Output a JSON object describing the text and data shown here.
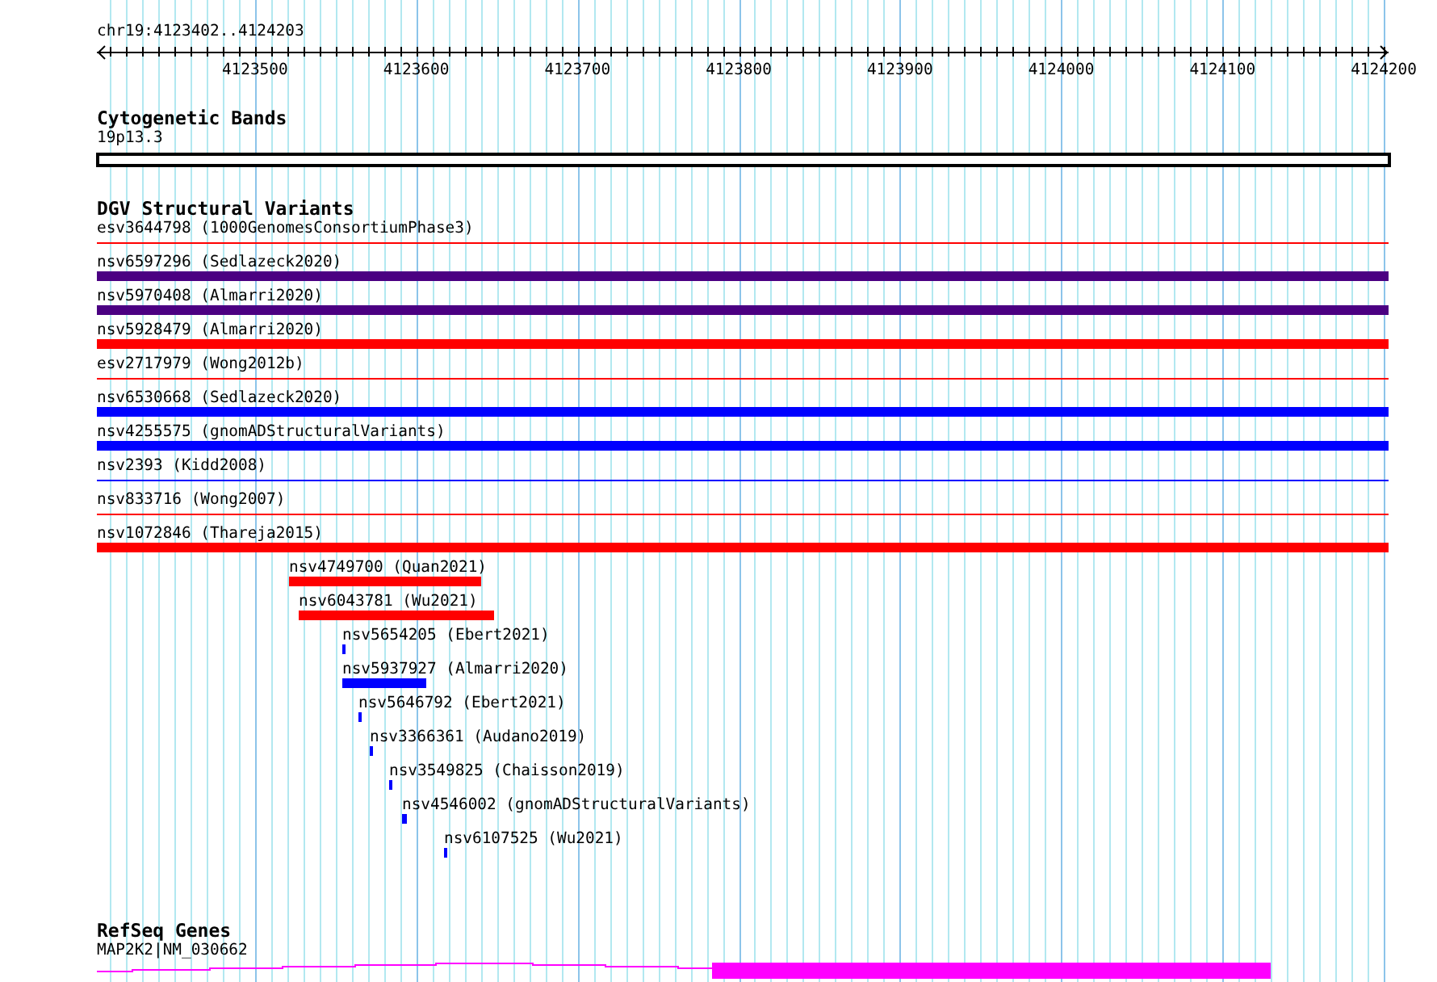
{
  "ruler": {
    "position": "chr19:4123402..4124203",
    "ticks": [
      "4123500",
      "4123600",
      "4123700",
      "4123800",
      "4123900",
      "4124000",
      "4124100",
      "4124200"
    ]
  },
  "tracks": [
    {
      "kind": "bands",
      "title": "Cytogenetic Bands",
      "label": "19p13.3"
    },
    {
      "kind": "variants",
      "title": "DGV Structural Variants",
      "rows": [
        {
          "label": "esv3644798 (1000GenomesConsortiumPhase3)",
          "kind": "line",
          "color": "#ff0000"
        },
        {
          "label": "nsv6597296 (Sedlazeck2020)",
          "kind": "bar",
          "color": "#4b0082"
        },
        {
          "label": "nsv5970408 (Almarri2020)",
          "kind": "bar",
          "color": "#4b0082"
        },
        {
          "label": "nsv5928479 (Almarri2020)",
          "kind": "bar",
          "color": "#ff0000"
        },
        {
          "label": "esv2717979 (Wong2012b)",
          "kind": "line",
          "color": "#ff0000"
        },
        {
          "label": "nsv6530668 (Sedlazeck2020)",
          "kind": "bar",
          "color": "#0000ff"
        },
        {
          "label": "nsv4255575 (gnomADStructuralVariants)",
          "kind": "bar",
          "color": "#0000ff"
        },
        {
          "label": "nsv2393 (Kidd2008)",
          "kind": "line",
          "color": "#0000ff"
        },
        {
          "label": "nsv833716 (Wong2007)",
          "kind": "line",
          "color": "#ff0000"
        },
        {
          "label": "nsv1072846 (Thareja2015)",
          "kind": "bar",
          "color": "#ff0000"
        }
      ],
      "packed": [
        {
          "label": "nsv4749700 (Quan2021)",
          "color": "#ff0000"
        },
        {
          "label": "nsv6043781 (Wu2021)",
          "color": "#ff0000"
        },
        {
          "label": "nsv5654205 (Ebert2021)",
          "color": "#0000ff"
        },
        {
          "label": "nsv5937927 (Almarri2020)",
          "color": "#0000ff"
        },
        {
          "label": "nsv5646792 (Ebert2021)",
          "color": "#0000ff"
        },
        {
          "label": "nsv3366361 (Audano2019)",
          "color": "#0000ff"
        },
        {
          "label": "nsv3549825 (Chaisson2019)",
          "color": "#0000ff"
        },
        {
          "label": "nsv4546002 (gnomADStructuralVariants)",
          "color": "#0000ff"
        },
        {
          "label": "nsv6107525 (Wu2021)",
          "color": "#0000ff"
        }
      ]
    },
    {
      "kind": "genes",
      "title": "RefSeq Genes",
      "label": "MAP2K2|NM_030662"
    }
  ]
}
